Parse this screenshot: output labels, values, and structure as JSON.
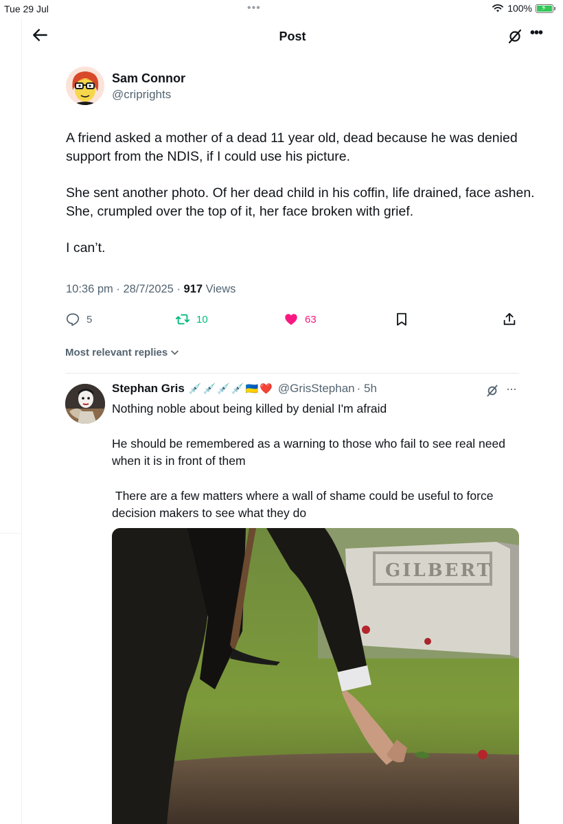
{
  "status_bar": {
    "time": "Tue 29 Jul",
    "dots": "•••",
    "battery_percent": "100%",
    "battery_level": 1.0,
    "battery_charging": true
  },
  "header": {
    "title": "Post",
    "back_icon": "arrow-left-icon",
    "grok_icon": "grok-icon",
    "more_icon": "more-dots-icon",
    "more_label": "•••"
  },
  "post": {
    "author_name": "Sam Connor",
    "author_handle": "@criprights",
    "paragraphs": [
      "A friend asked a mother of a dead 11 year old, dead because he was denied support from the NDIS, if I could use his picture.",
      "She sent another photo. Of her dead child in his coffin, life drained, face ashen. She, crumpled over the top of it, her face broken with grief.",
      "I can’t."
    ],
    "timestamp": "10:36 pm · 28/7/2025 · ",
    "views_count": "917",
    "views_label": " Views"
  },
  "actions": {
    "reply_count": "5",
    "repost_count": "10",
    "like_count": "63",
    "colors": {
      "repost": "#00ba7c",
      "like": "#f91880",
      "muted": "#536471"
    }
  },
  "replies_sort": {
    "label": "Most relevant replies",
    "icon": "chevron-down-icon"
  },
  "reply": {
    "author_name": "Stephan Gris",
    "emoji": "💉💉💉💉🇺🇦❤️",
    "handle": "@GrisStephan",
    "time_suffix": "· 5h",
    "more_label": "···",
    "paragraphs": [
      "Nothing noble about being killed by denial I'm afraid",
      "He should be remembered as a warning to those who fail to see real need when it is in front of them",
      " There are a few matters where a wall of shame could be useful to force decision makers to see what they do"
    ],
    "media": {
      "description_icon": "photo-grave-scene",
      "headstone_text": "GILBERT"
    }
  }
}
